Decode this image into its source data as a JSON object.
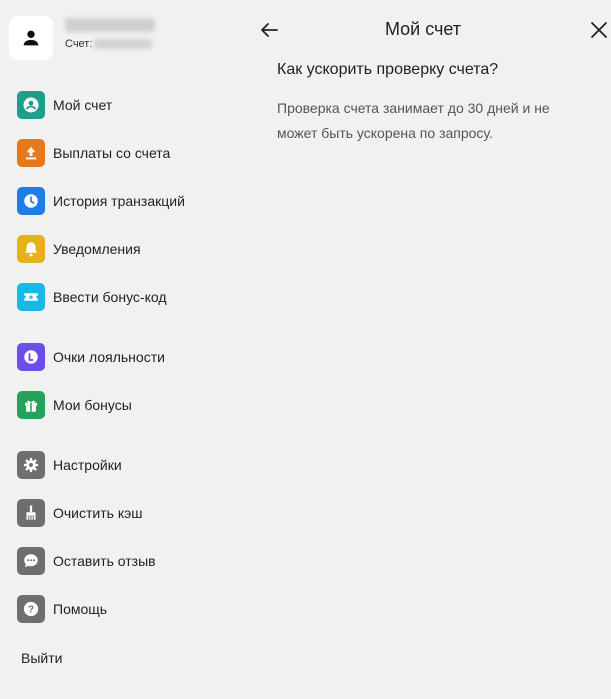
{
  "header": {
    "title": "Мой счет"
  },
  "user": {
    "name": "",
    "account_label": "Счет:",
    "account_number": ""
  },
  "menu": [
    {
      "label": "Мой счет",
      "icon": "account-circle-icon",
      "color": "#1e9f8e"
    },
    {
      "label": "Выплаты со счета",
      "icon": "upload-icon",
      "color": "#e8781c"
    },
    {
      "label": "История транзакций",
      "icon": "clock-icon",
      "color": "#1e7ee8"
    },
    {
      "label": "Уведомления",
      "icon": "bell-icon",
      "color": "#e6b21b"
    },
    {
      "label": "Ввести бонус-код",
      "icon": "ticket-icon",
      "color": "#16b8e6"
    },
    {
      "label": "Очки лояльности",
      "icon": "loyalty-coin-icon",
      "color": "#6b4ee8"
    },
    {
      "label": "Мои бонусы",
      "icon": "gift-icon",
      "color": "#25a35a"
    },
    {
      "label": "Настройки",
      "icon": "gear-icon",
      "color": "#6e6e6e"
    },
    {
      "label": "Очистить кэш",
      "icon": "broom-icon",
      "color": "#6e6e6e"
    },
    {
      "label": "Оставить отзыв",
      "icon": "chat-icon",
      "color": "#6e6e6e"
    },
    {
      "label": "Помощь",
      "icon": "help-icon",
      "color": "#6e6e6e"
    }
  ],
  "logout_label": "Выйти",
  "faq": {
    "question": "Как ускорить проверку счета?",
    "answer": "Проверка счета занимает до 30 дней и не может быть ускорена по запросу."
  }
}
